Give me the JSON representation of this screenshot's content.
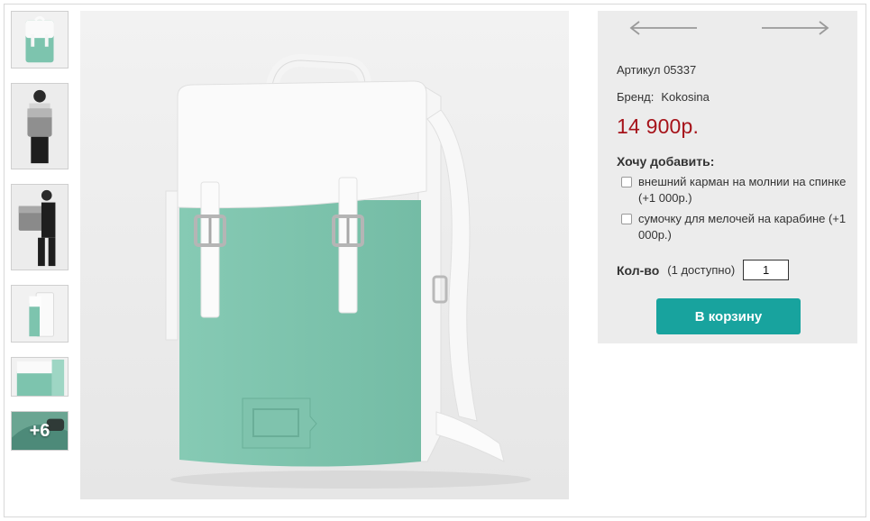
{
  "gallery": {
    "thumbnails": [
      {
        "icon": "backpack-front-thumbnail"
      },
      {
        "icon": "person-wearing-backpack-back-thumbnail"
      },
      {
        "icon": "person-carrying-backpack-thumbnail"
      },
      {
        "icon": "backpack-side-thumbnail"
      },
      {
        "icon": "backpack-detail-thumbnail"
      },
      {
        "icon": "backpack-more-thumbnail",
        "overlay_label": "+6"
      }
    ],
    "main_image": {
      "icon": "mint-suede-backpack-photo"
    }
  },
  "product": {
    "nav": {
      "prev_icon": "arrow-left-icon",
      "next_icon": "arrow-right-icon"
    },
    "sku": "Артикул 05337",
    "brand_label": "Бренд:",
    "brand_value": "Kokosina",
    "price": "14 900р.",
    "addons_title": "Хочу добавить:",
    "addons": [
      {
        "label": "внешний карман на молнии на спинке (+1 000р.)",
        "checked": false
      },
      {
        "label": "сумочку для мелочей на карабине (+1 000р.)",
        "checked": false
      }
    ],
    "quantity": {
      "label": "Кол-во",
      "available": "(1 доступно)",
      "value": "1"
    },
    "add_to_cart_label": "В корзину"
  },
  "colors": {
    "price": "#a6131a",
    "button": "#18a39e",
    "mint": "#7dc4ae",
    "panel_bg": "#ececec"
  }
}
